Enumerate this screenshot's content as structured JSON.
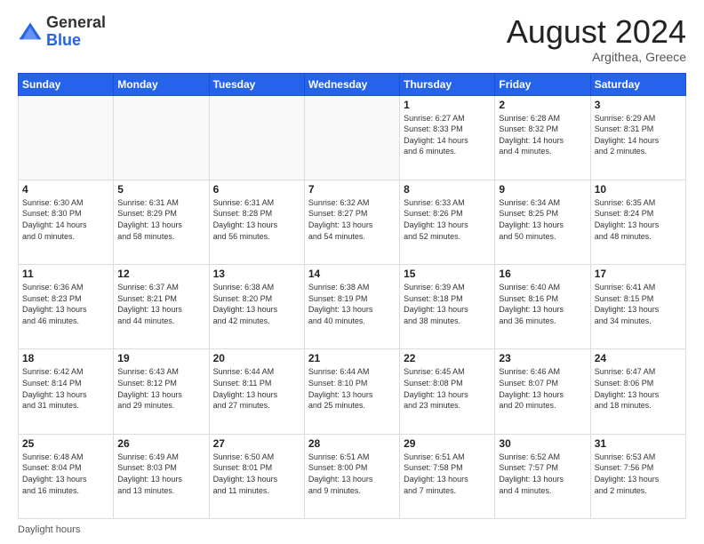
{
  "header": {
    "logo_general": "General",
    "logo_blue": "Blue",
    "month_title": "August 2024",
    "subtitle": "Argithea, Greece"
  },
  "footer": {
    "label": "Daylight hours"
  },
  "days_of_week": [
    "Sunday",
    "Monday",
    "Tuesday",
    "Wednesday",
    "Thursday",
    "Friday",
    "Saturday"
  ],
  "weeks": [
    [
      {
        "day": "",
        "detail": ""
      },
      {
        "day": "",
        "detail": ""
      },
      {
        "day": "",
        "detail": ""
      },
      {
        "day": "",
        "detail": ""
      },
      {
        "day": "1",
        "detail": "Sunrise: 6:27 AM\nSunset: 8:33 PM\nDaylight: 14 hours\nand 6 minutes."
      },
      {
        "day": "2",
        "detail": "Sunrise: 6:28 AM\nSunset: 8:32 PM\nDaylight: 14 hours\nand 4 minutes."
      },
      {
        "day": "3",
        "detail": "Sunrise: 6:29 AM\nSunset: 8:31 PM\nDaylight: 14 hours\nand 2 minutes."
      }
    ],
    [
      {
        "day": "4",
        "detail": "Sunrise: 6:30 AM\nSunset: 8:30 PM\nDaylight: 14 hours\nand 0 minutes."
      },
      {
        "day": "5",
        "detail": "Sunrise: 6:31 AM\nSunset: 8:29 PM\nDaylight: 13 hours\nand 58 minutes."
      },
      {
        "day": "6",
        "detail": "Sunrise: 6:31 AM\nSunset: 8:28 PM\nDaylight: 13 hours\nand 56 minutes."
      },
      {
        "day": "7",
        "detail": "Sunrise: 6:32 AM\nSunset: 8:27 PM\nDaylight: 13 hours\nand 54 minutes."
      },
      {
        "day": "8",
        "detail": "Sunrise: 6:33 AM\nSunset: 8:26 PM\nDaylight: 13 hours\nand 52 minutes."
      },
      {
        "day": "9",
        "detail": "Sunrise: 6:34 AM\nSunset: 8:25 PM\nDaylight: 13 hours\nand 50 minutes."
      },
      {
        "day": "10",
        "detail": "Sunrise: 6:35 AM\nSunset: 8:24 PM\nDaylight: 13 hours\nand 48 minutes."
      }
    ],
    [
      {
        "day": "11",
        "detail": "Sunrise: 6:36 AM\nSunset: 8:23 PM\nDaylight: 13 hours\nand 46 minutes."
      },
      {
        "day": "12",
        "detail": "Sunrise: 6:37 AM\nSunset: 8:21 PM\nDaylight: 13 hours\nand 44 minutes."
      },
      {
        "day": "13",
        "detail": "Sunrise: 6:38 AM\nSunset: 8:20 PM\nDaylight: 13 hours\nand 42 minutes."
      },
      {
        "day": "14",
        "detail": "Sunrise: 6:38 AM\nSunset: 8:19 PM\nDaylight: 13 hours\nand 40 minutes."
      },
      {
        "day": "15",
        "detail": "Sunrise: 6:39 AM\nSunset: 8:18 PM\nDaylight: 13 hours\nand 38 minutes."
      },
      {
        "day": "16",
        "detail": "Sunrise: 6:40 AM\nSunset: 8:16 PM\nDaylight: 13 hours\nand 36 minutes."
      },
      {
        "day": "17",
        "detail": "Sunrise: 6:41 AM\nSunset: 8:15 PM\nDaylight: 13 hours\nand 34 minutes."
      }
    ],
    [
      {
        "day": "18",
        "detail": "Sunrise: 6:42 AM\nSunset: 8:14 PM\nDaylight: 13 hours\nand 31 minutes."
      },
      {
        "day": "19",
        "detail": "Sunrise: 6:43 AM\nSunset: 8:12 PM\nDaylight: 13 hours\nand 29 minutes."
      },
      {
        "day": "20",
        "detail": "Sunrise: 6:44 AM\nSunset: 8:11 PM\nDaylight: 13 hours\nand 27 minutes."
      },
      {
        "day": "21",
        "detail": "Sunrise: 6:44 AM\nSunset: 8:10 PM\nDaylight: 13 hours\nand 25 minutes."
      },
      {
        "day": "22",
        "detail": "Sunrise: 6:45 AM\nSunset: 8:08 PM\nDaylight: 13 hours\nand 23 minutes."
      },
      {
        "day": "23",
        "detail": "Sunrise: 6:46 AM\nSunset: 8:07 PM\nDaylight: 13 hours\nand 20 minutes."
      },
      {
        "day": "24",
        "detail": "Sunrise: 6:47 AM\nSunset: 8:06 PM\nDaylight: 13 hours\nand 18 minutes."
      }
    ],
    [
      {
        "day": "25",
        "detail": "Sunrise: 6:48 AM\nSunset: 8:04 PM\nDaylight: 13 hours\nand 16 minutes."
      },
      {
        "day": "26",
        "detail": "Sunrise: 6:49 AM\nSunset: 8:03 PM\nDaylight: 13 hours\nand 13 minutes."
      },
      {
        "day": "27",
        "detail": "Sunrise: 6:50 AM\nSunset: 8:01 PM\nDaylight: 13 hours\nand 11 minutes."
      },
      {
        "day": "28",
        "detail": "Sunrise: 6:51 AM\nSunset: 8:00 PM\nDaylight: 13 hours\nand 9 minutes."
      },
      {
        "day": "29",
        "detail": "Sunrise: 6:51 AM\nSunset: 7:58 PM\nDaylight: 13 hours\nand 7 minutes."
      },
      {
        "day": "30",
        "detail": "Sunrise: 6:52 AM\nSunset: 7:57 PM\nDaylight: 13 hours\nand 4 minutes."
      },
      {
        "day": "31",
        "detail": "Sunrise: 6:53 AM\nSunset: 7:56 PM\nDaylight: 13 hours\nand 2 minutes."
      }
    ]
  ]
}
